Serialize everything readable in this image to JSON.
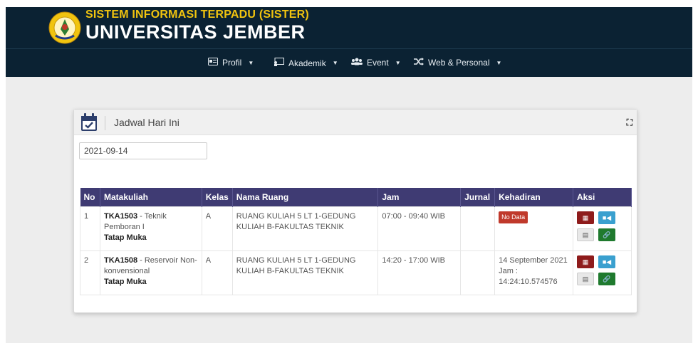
{
  "header": {
    "line1": "SISTEM INFORMASI TERPADU (SISTER)",
    "line2": "UNIVERSITAS JEMBER",
    "logo_text": "UNIVERSITAS JEMBER"
  },
  "nav": {
    "items": [
      {
        "label": "Profil",
        "icon": "id-card-icon"
      },
      {
        "label": "Akademik",
        "icon": "chalkboard-icon"
      },
      {
        "label": "Event",
        "icon": "users-icon"
      },
      {
        "label": "Web & Personal",
        "icon": "random-icon"
      }
    ]
  },
  "card": {
    "title": "Jadwal Hari Ini",
    "date_value": "2021-09-14"
  },
  "table": {
    "headers": [
      "No",
      "Matakuliah",
      "Kelas",
      "Nama Ruang",
      "Jam",
      "Jurnal",
      "Kehadiran",
      "Aksi"
    ],
    "rows": [
      {
        "no": "1",
        "code": "TKA1503",
        "name": " - Teknik Pemboran I",
        "mode": "Tatap Muka",
        "kelas": "A",
        "ruang": "RUANG KULIAH 5 LT 1-GEDUNG KULIAH B-FAKULTAS TEKNIK",
        "jam": "07:00 - 09:40 WIB",
        "jurnal": "",
        "kehadiran_badge": "No Data",
        "kehadiran": ""
      },
      {
        "no": "2",
        "code": "TKA1508",
        "name": " - Reservoir Non-konvensional",
        "mode": "Tatap Muka",
        "kelas": "A",
        "ruang": "RUANG KULIAH 5 LT 1-GEDUNG KULIAH B-FAKULTAS TEKNIK",
        "jam": "14:20 - 17:00 WIB",
        "jurnal": "",
        "kehadiran_badge": "",
        "kehadiran": "14 September 2021 Jam : 14:24:10.574576"
      }
    ]
  },
  "colors": {
    "header_bg": "#0b2233",
    "table_head": "#3f3b73",
    "brand_yellow": "#f1c40f"
  }
}
